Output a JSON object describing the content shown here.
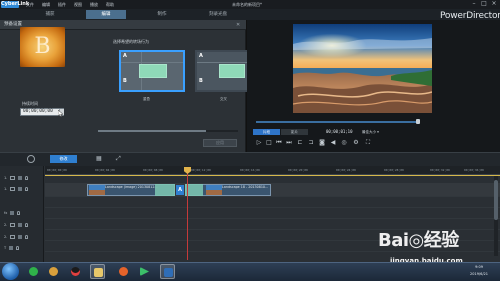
{
  "window": {
    "app_logo": "CyberLink",
    "brand": "PowerDirector",
    "title": "未命名的新项目*",
    "menus": [
      "文件",
      "编辑",
      "插件",
      "视图",
      "播放",
      "帮助"
    ]
  },
  "mode_tabs": [
    "捕获",
    "编辑",
    "制作",
    "刻录光盘"
  ],
  "panel": {
    "title": "预备设置",
    "preview_letter": "B",
    "behavior_label": "选择希望的转场行为",
    "templates": [
      {
        "a": "A",
        "b": "B",
        "label": "重叠"
      },
      {
        "a": "A",
        "b": "B",
        "label": "交叉"
      }
    ],
    "duration_label": "持续时间",
    "duration_value": "00;00;00;00",
    "apply_label": "应用"
  },
  "preview": {
    "clip_tab": "片段",
    "movie_tab": "影片",
    "timecode": "00;00;01;10",
    "quality": "最佳大小 ▾",
    "controls": [
      "play-icon",
      "stop-icon",
      "prev-frame-icon",
      "next-frame-icon",
      "snapshot-icon",
      "volume-icon",
      "3d-icon",
      "fullscreen-icon"
    ]
  },
  "toolbar": {
    "edit_label": "修改"
  },
  "timeline": {
    "ticks": [
      "00;00;00;00",
      "00;00;04;00",
      "00;00;08;00",
      "00;00;12;00",
      "00;00;16;00",
      "00;00;20;00",
      "00;00;24;00",
      "00;00;28;00",
      "00;00;32;00",
      "00;00;36;00"
    ],
    "clip1": "Landscape (image) 20130812...",
    "clip2": "Landscape 18 - 20130810...",
    "transition": "A",
    "tracks": [
      "1.",
      "1.",
      "fx",
      "2.",
      "2.",
      "T"
    ]
  },
  "tray": {
    "time": "9:09",
    "date": "2019/6/21"
  },
  "watermark": {
    "logo": "Bai◎经验",
    "url": "jingyan.baidu.com"
  },
  "colors": {
    "accent": "#2f7fd0",
    "selected_border": "#3aa0ff",
    "transition": "#7fc9b4",
    "playhead": "#c43a3a"
  }
}
